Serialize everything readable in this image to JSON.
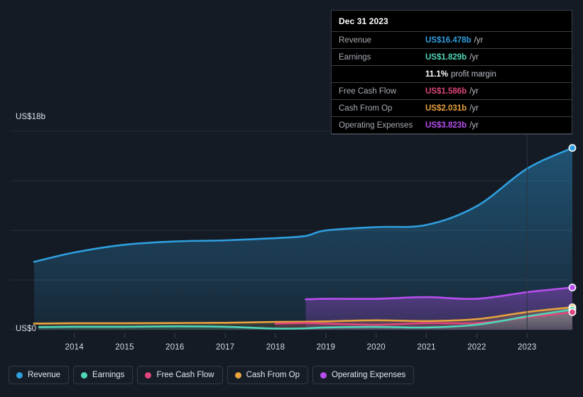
{
  "colors": {
    "background": "#151b24",
    "revenue": "#2f9fe0",
    "earnings": "#4fd6b8",
    "free_cash_flow": "#e0457b",
    "cash_from_op": "#e8a33d",
    "operating_expenses": "#b84ff0",
    "gridline": "#262d38",
    "tooltip_bg": "#000000",
    "tooltip_border": "#3a3f47"
  },
  "tooltip": {
    "date": "Dec 31 2023",
    "rows": [
      {
        "name": "Revenue",
        "value": "US$16.478b",
        "unit": "/yr",
        "color": "#2f9fe0"
      },
      {
        "name": "Earnings",
        "value": "US$1.829b",
        "unit": "/yr",
        "color": "#4fd6b8"
      },
      {
        "name": "",
        "value": "11.1%",
        "unit": "profit margin",
        "color": "#ffffff"
      },
      {
        "name": "Free Cash Flow",
        "value": "US$1.586b",
        "unit": "/yr",
        "color": "#e0457b"
      },
      {
        "name": "Cash From Op",
        "value": "US$2.031b",
        "unit": "/yr",
        "color": "#e8a33d"
      },
      {
        "name": "Operating Expenses",
        "value": "US$3.823b",
        "unit": "/yr",
        "color": "#b84ff0"
      }
    ]
  },
  "legend": {
    "items": [
      {
        "label": "Revenue",
        "color": "#2f9fe0"
      },
      {
        "label": "Earnings",
        "color": "#4fd6b8"
      },
      {
        "label": "Free Cash Flow",
        "color": "#e0457b"
      },
      {
        "label": "Cash From Op",
        "color": "#e8a33d"
      },
      {
        "label": "Operating Expenses",
        "color": "#b84ff0"
      }
    ]
  },
  "axes": {
    "y_top_label": "US$18b",
    "y_zero_label": "US$0",
    "x_labels": [
      "2014",
      "2015",
      "2016",
      "2017",
      "2018",
      "2019",
      "2020",
      "2021",
      "2022",
      "2023"
    ]
  },
  "chart_data": {
    "type": "area",
    "title": "",
    "xlabel": "",
    "ylabel": "US$ (billions)",
    "ylim": [
      0,
      18
    ],
    "grid": true,
    "legend_position": "bottom",
    "x": [
      2013.2,
      2014,
      2015,
      2016,
      2017,
      2018,
      2018.6,
      2019,
      2020,
      2021,
      2022,
      2023,
      2023.9
    ],
    "series": [
      {
        "name": "Revenue",
        "color": "#2f9fe0",
        "values": [
          6.15,
          7.0,
          7.7,
          8.0,
          8.1,
          8.3,
          8.5,
          9.0,
          9.3,
          9.5,
          11.2,
          14.6,
          16.478
        ]
      },
      {
        "name": "Earnings",
        "color": "#4fd6b8",
        "values": [
          0.22,
          0.26,
          0.26,
          0.3,
          0.26,
          0.1,
          0.12,
          0.2,
          0.25,
          0.2,
          0.45,
          1.2,
          1.829
        ]
      },
      {
        "name": "Free Cash Flow",
        "color": "#e0457b",
        "values": [
          null,
          null,
          null,
          null,
          null,
          0.55,
          0.6,
          0.55,
          0.45,
          0.6,
          0.6,
          1.1,
          1.586
        ]
      },
      {
        "name": "Cash From Op",
        "color": "#e8a33d",
        "values": [
          0.55,
          0.58,
          0.58,
          0.6,
          0.62,
          0.7,
          0.72,
          0.75,
          0.85,
          0.78,
          0.95,
          1.6,
          2.031
        ]
      },
      {
        "name": "Operating Expenses",
        "color": "#b84ff0",
        "values": [
          null,
          null,
          null,
          null,
          null,
          null,
          2.75,
          2.8,
          2.8,
          2.95,
          2.8,
          3.4,
          3.823
        ]
      }
    ],
    "end_markers": [
      {
        "series": "Revenue",
        "value": 16.478
      },
      {
        "series": "Operating Expenses",
        "value": 3.823
      },
      {
        "series": "Cash From Op",
        "value": 2.031
      },
      {
        "series": "Earnings",
        "value": 1.829
      },
      {
        "series": "Free Cash Flow",
        "value": 1.586
      }
    ]
  }
}
